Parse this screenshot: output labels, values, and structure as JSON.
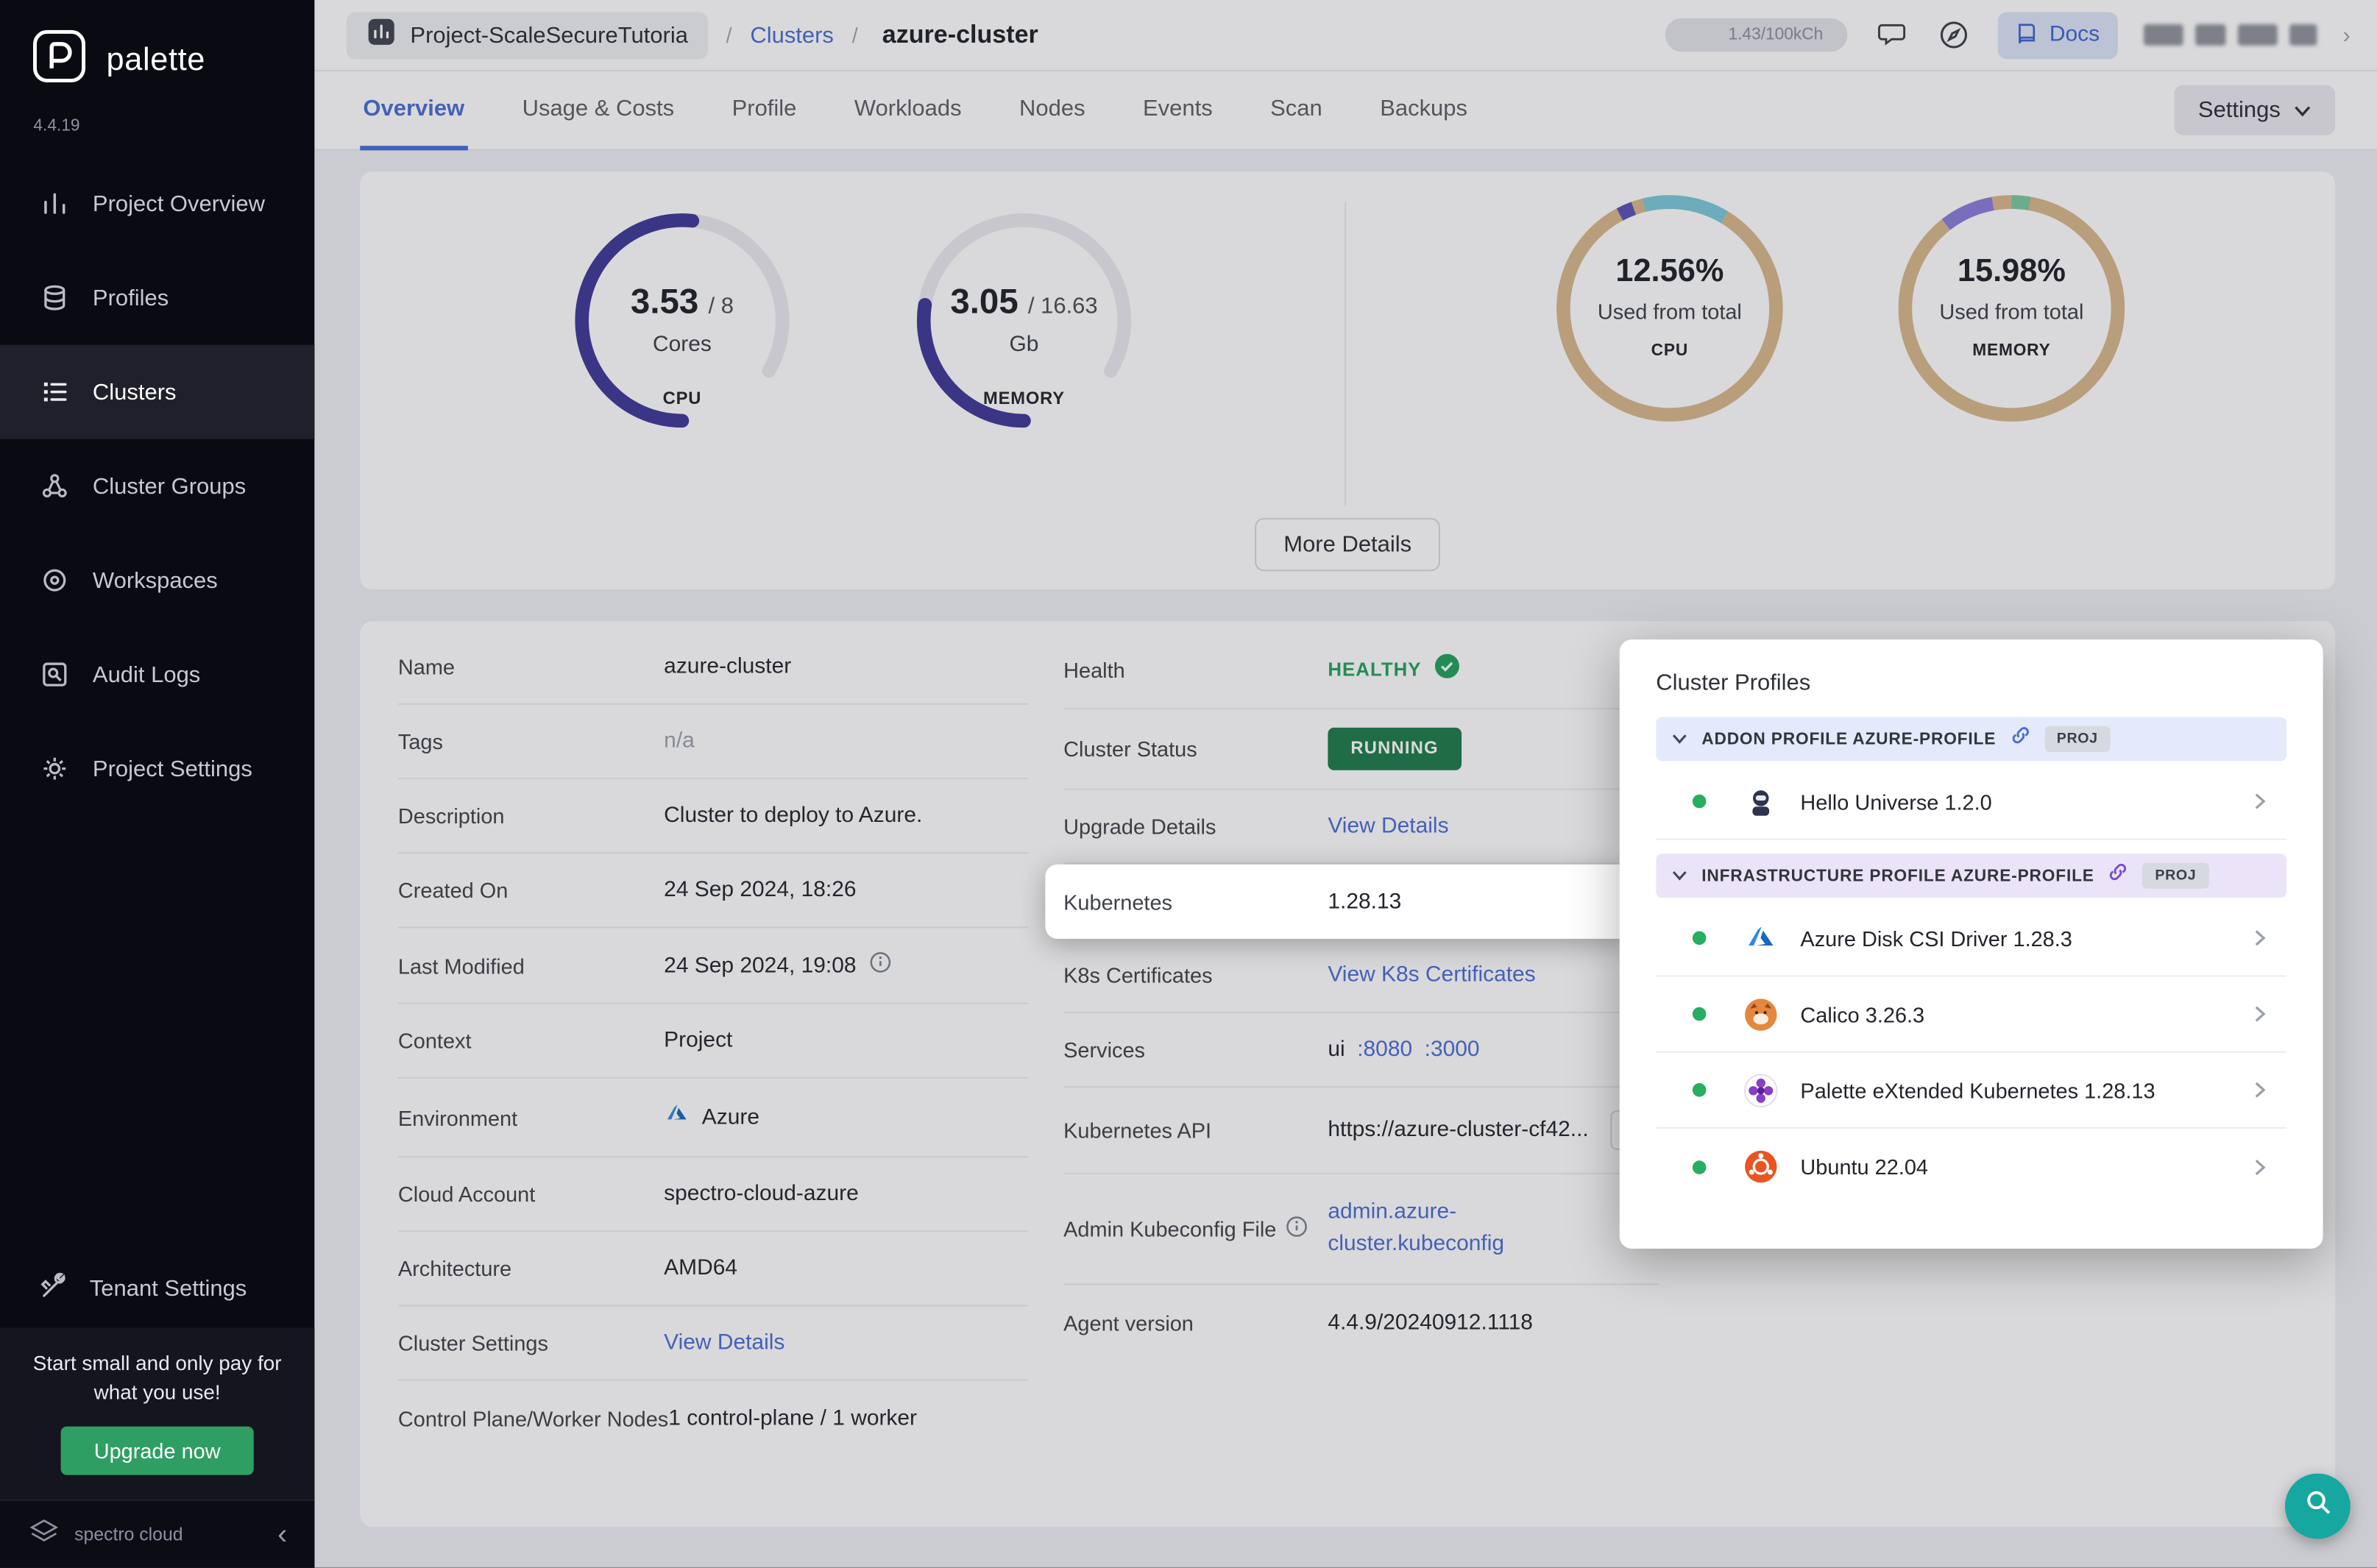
{
  "colors": {
    "accent": "#4a6cd3",
    "running_badge": "#1e7a4a",
    "healthy_green": "#21a15c",
    "fab_teal": "#16a7a0",
    "sidebar_bg": "#0a0a13",
    "gauge_progress": "#3f3896",
    "donut_base": "#d8b88c"
  },
  "sidebar": {
    "brand": "palette",
    "version": "4.4.19",
    "items": [
      {
        "label": "Project Overview"
      },
      {
        "label": "Profiles"
      },
      {
        "label": "Clusters"
      },
      {
        "label": "Cluster Groups"
      },
      {
        "label": "Workspaces"
      },
      {
        "label": "Audit Logs"
      },
      {
        "label": "Project Settings"
      }
    ],
    "tenant_settings": "Tenant Settings",
    "promo_text": "Start small and only pay for what you use!",
    "upgrade_button": "Upgrade now",
    "footer_brand": "spectro cloud"
  },
  "header": {
    "project": "Project-ScaleSecureTutoria",
    "sep": "/",
    "breadcrumb_section": "Clusters",
    "breadcrumb_current": "azure-cluster",
    "usage": "1.43/100kCh",
    "docs": "Docs"
  },
  "tabs": {
    "items": [
      "Overview",
      "Usage & Costs",
      "Profile",
      "Workloads",
      "Nodes",
      "Events",
      "Scan",
      "Backups"
    ],
    "settings": "Settings"
  },
  "metrics": {
    "cpu_gauge": {
      "value": "3.53",
      "total": "/ 8",
      "unit": "Cores",
      "label": "CPU"
    },
    "memory_gauge": {
      "value": "3.05",
      "total": "/ 16.63",
      "unit": "Gb",
      "label": "MEMORY"
    },
    "cpu_donut": {
      "percent": "12.56%",
      "caption": "Used from total",
      "label": "CPU"
    },
    "memory_donut": {
      "percent": "15.98%",
      "caption": "Used from total",
      "label": "MEMORY"
    },
    "more_details": "More Details"
  },
  "details": {
    "left": [
      {
        "label": "Name",
        "value": "azure-cluster"
      },
      {
        "label": "Tags",
        "value": "n/a"
      },
      {
        "label": "Description",
        "value": "Cluster to deploy to Azure."
      },
      {
        "label": "Created On",
        "value": "24 Sep 2024, 18:26"
      },
      {
        "label": "Last Modified",
        "value": "24 Sep 2024, 19:08"
      },
      {
        "label": "Context",
        "value": "Project"
      },
      {
        "label": "Environment",
        "value": "Azure"
      },
      {
        "label": "Cloud Account",
        "value": "spectro-cloud-azure"
      },
      {
        "label": "Architecture",
        "value": "AMD64"
      },
      {
        "label": "Cluster Settings",
        "value": "View Details"
      },
      {
        "label": "Control Plane/Worker Nodes",
        "value": "1 control-plane / 1 worker"
      }
    ],
    "right": {
      "health_label": "Health",
      "health_value": "HEALTHY",
      "status_label": "Cluster Status",
      "status_value": "RUNNING",
      "upgrade_label": "Upgrade Details",
      "upgrade_value": "View Details",
      "kubernetes_label": "Kubernetes",
      "kubernetes_value": "1.28.13",
      "certs_label": "K8s Certificates",
      "certs_value": "View K8s Certificates",
      "services_label": "Services",
      "services_name": "ui",
      "services_port1": ":8080",
      "services_port2": ":3000",
      "api_label": "Kubernetes API",
      "api_value": "https://azure-cluster-cf42...",
      "kubeconfig_label": "Admin Kubeconfig File",
      "kubeconfig_value": "admin.azure-cluster.kubeconfig",
      "agent_label": "Agent version",
      "agent_value": "4.4.9/20240912.1118"
    }
  },
  "profiles": {
    "title": "Cluster Profiles",
    "groups": [
      {
        "name": "ADDON PROFILE AZURE-PROFILE",
        "badge": "PROJ",
        "items": [
          {
            "name": "Hello Universe 1.2.0"
          }
        ]
      },
      {
        "name": "INFRASTRUCTURE PROFILE AZURE-PROFILE",
        "badge": "PROJ",
        "items": [
          {
            "name": "Azure Disk CSI Driver 1.28.3"
          },
          {
            "name": "Calico 3.26.3"
          },
          {
            "name": "Palette eXtended Kubernetes 1.28.13"
          },
          {
            "name": "Ubuntu 22.04"
          }
        ]
      }
    ]
  }
}
